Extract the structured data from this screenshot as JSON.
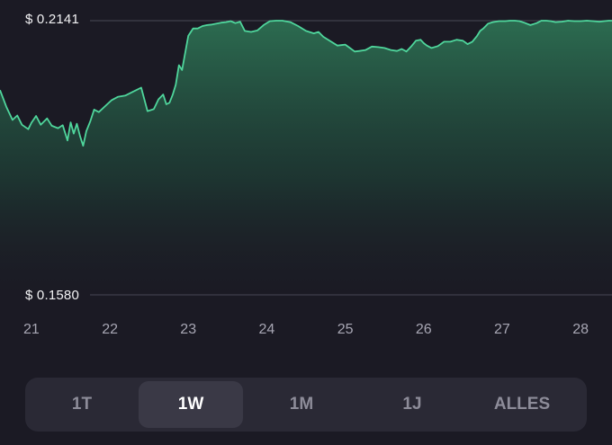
{
  "chart_data": {
    "type": "area",
    "y_top_label": "$ 0.2141",
    "y_bottom_label": "$ 0.1580",
    "ylim": [
      0.158,
      0.2141
    ],
    "x_tick_labels": [
      "21",
      "22",
      "23",
      "24",
      "25",
      "26",
      "27",
      "28"
    ],
    "xlim": [
      20.6,
      28.4
    ],
    "line_color": "#4fd69c",
    "series": [
      {
        "x": [
          20.6,
          20.68,
          20.76,
          20.82,
          20.88,
          20.96,
          21.0,
          21.06,
          21.12,
          21.2,
          21.26,
          21.34,
          21.4,
          21.46,
          21.5,
          21.54,
          21.58,
          21.62,
          21.66,
          21.7,
          21.75,
          21.8,
          21.86,
          21.94,
          22.02,
          22.1,
          22.2,
          22.3,
          22.4,
          22.48,
          22.56,
          22.62,
          22.68,
          22.72,
          22.76,
          22.8,
          22.84,
          22.88,
          22.92,
          23.0,
          23.06,
          23.12,
          23.18,
          23.24,
          23.3,
          23.36,
          23.42,
          23.48,
          23.54,
          23.6,
          23.66,
          23.72,
          23.8,
          23.88,
          23.96,
          24.04,
          24.12,
          24.2,
          24.3,
          24.4,
          24.5,
          24.6,
          24.66,
          24.72,
          24.8,
          24.9,
          25.0,
          25.06,
          25.12,
          25.18,
          25.26,
          25.34,
          25.42,
          25.5,
          25.58,
          25.66,
          25.72,
          25.78,
          25.84,
          25.9,
          25.96,
          26.0,
          26.04,
          26.1,
          26.18,
          26.26,
          26.34,
          26.42,
          26.5,
          26.56,
          26.62,
          26.68,
          26.72,
          26.76,
          26.82,
          26.88,
          26.96,
          27.04,
          27.1,
          27.16,
          27.22,
          27.28,
          27.36,
          27.44,
          27.5,
          27.56,
          27.62,
          27.68,
          27.76,
          27.84,
          27.92,
          28.0,
          28.08,
          28.16,
          28.24,
          28.3,
          28.36,
          28.4
        ],
        "values": [
          0.1999,
          0.1965,
          0.1938,
          0.1947,
          0.1928,
          0.1919,
          0.1932,
          0.1946,
          0.1928,
          0.1941,
          0.1926,
          0.1921,
          0.1927,
          0.1896,
          0.1933,
          0.191,
          0.193,
          0.1905,
          0.1885,
          0.1915,
          0.1935,
          0.1959,
          0.1954,
          0.1966,
          0.1978,
          0.1985,
          0.1988,
          0.1996,
          0.2004,
          0.1956,
          0.196,
          0.198,
          0.199,
          0.197,
          0.1973,
          0.1989,
          0.201,
          0.205,
          0.204,
          0.211,
          0.2125,
          0.2125,
          0.213,
          0.2132,
          0.2133,
          0.2135,
          0.2137,
          0.2138,
          0.214,
          0.2136,
          0.2139,
          0.212,
          0.2118,
          0.2121,
          0.2132,
          0.214,
          0.2141,
          0.2141,
          0.2138,
          0.213,
          0.212,
          0.2115,
          0.2118,
          0.2108,
          0.21,
          0.209,
          0.2092,
          0.2085,
          0.2078,
          0.2079,
          0.2081,
          0.2088,
          0.2087,
          0.2085,
          0.2081,
          0.2079,
          0.2083,
          0.2078,
          0.2088,
          0.21,
          0.2102,
          0.2095,
          0.209,
          0.2085,
          0.2089,
          0.2098,
          0.2098,
          0.2102,
          0.21,
          0.2093,
          0.2098,
          0.211,
          0.212,
          0.2125,
          0.2135,
          0.2138,
          0.214,
          0.214,
          0.2141,
          0.2141,
          0.214,
          0.2137,
          0.2132,
          0.2136,
          0.2141,
          0.2141,
          0.214,
          0.2138,
          0.2139,
          0.2141,
          0.214,
          0.214,
          0.2141,
          0.214,
          0.2139,
          0.214,
          0.2141,
          0.2141
        ]
      }
    ],
    "grid": "top and bottom price lines only",
    "fill": "green gradient under line"
  },
  "time_ranges": [
    {
      "label": "1T",
      "active": false
    },
    {
      "label": "1W",
      "active": true
    },
    {
      "label": "1M",
      "active": false
    },
    {
      "label": "1J",
      "active": false
    },
    {
      "label": "ALLES",
      "active": false
    }
  ],
  "colors": {
    "background": "#1b1a24",
    "line": "#4fd69c",
    "range_bar": "#2a2935",
    "range_active": "#3a3946",
    "tick_text": "#a7a6b3"
  }
}
